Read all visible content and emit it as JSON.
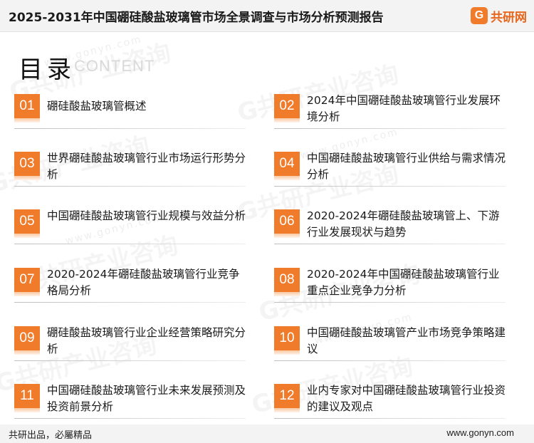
{
  "header": {
    "title": "2025-2031年中国硼硅酸盐玻璃管市场全景调查与市场分析预测报告",
    "logo_mark": "G",
    "logo_text": "共研网"
  },
  "section": {
    "title": "目录",
    "subtitle": "CONTENT"
  },
  "toc": [
    {
      "num": "01",
      "label": "硼硅酸盐玻璃管概述"
    },
    {
      "num": "02",
      "label": "2024年中国硼硅酸盐玻璃管行业发展环境分析"
    },
    {
      "num": "03",
      "label": "世界硼硅酸盐玻璃管行业市场运行形势分析"
    },
    {
      "num": "04",
      "label": "中国硼硅酸盐玻璃管行业供给与需求情况分析"
    },
    {
      "num": "05",
      "label": "中国硼硅酸盐玻璃管行业规模与效益分析"
    },
    {
      "num": "06",
      "label": "2020-2024年硼硅酸盐玻璃管上、下游行业发展现状与趋势"
    },
    {
      "num": "07",
      "label": "2020-2024年硼硅酸盐玻璃管行业竞争格局分析"
    },
    {
      "num": "08",
      "label": "2020-2024年中国硼硅酸盐玻璃管行业重点企业竞争力分析"
    },
    {
      "num": "09",
      "label": "硼硅酸盐玻璃管行业企业经营策略研究分析"
    },
    {
      "num": "10",
      "label": "中国硼硅酸盐玻璃管产业市场竞争策略建议"
    },
    {
      "num": "11",
      "label": "中国硼硅酸盐玻璃管行业未来发展预测及投资前景分析"
    },
    {
      "num": "12",
      "label": "业内专家对中国硼硅酸盐玻璃管行业投资的建议及观点"
    }
  ],
  "watermark": {
    "text": "G共研产业咨询",
    "url": "www.gonyn.com"
  },
  "footer": {
    "slogan": "共研出品，必屬精品",
    "website": "www.gonyn.com"
  },
  "colors": {
    "accent": "#f07b2a",
    "logo": "#e8651c"
  }
}
